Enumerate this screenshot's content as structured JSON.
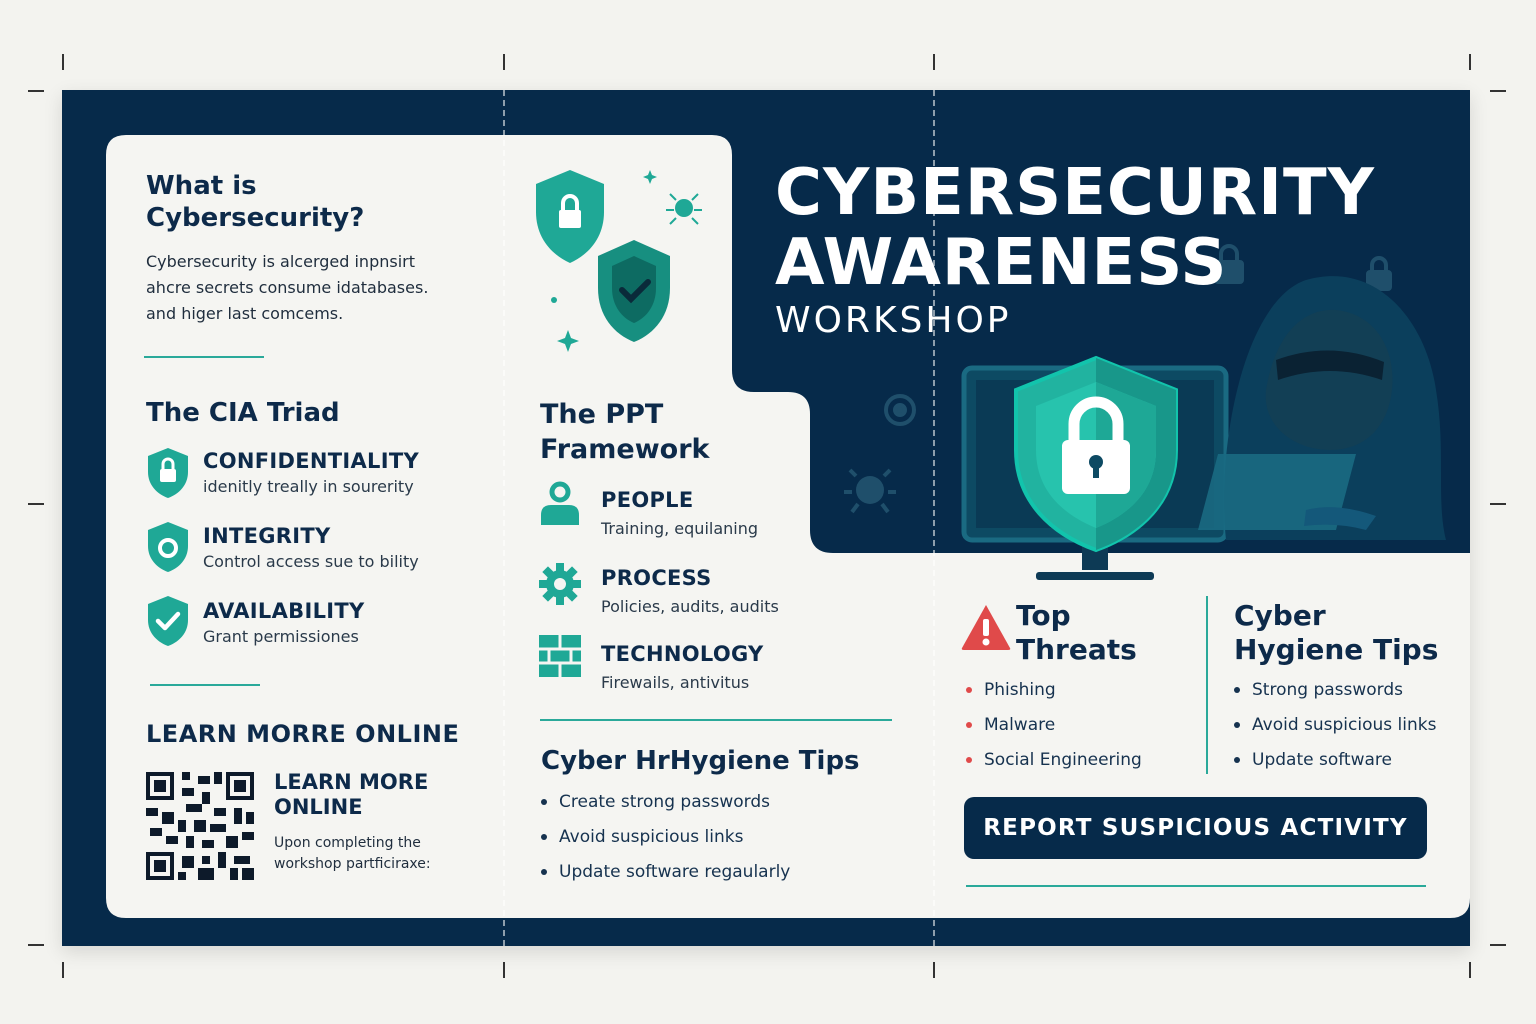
{
  "panel_left": {
    "what_is": {
      "heading": "What is Cybersecurity?",
      "line1": "Cybersecurity is alcerged inpnsirt",
      "line2": "ahcre secrets consume idatabases.",
      "line3": "and higer last comcems."
    },
    "cia": {
      "heading": "The CIA Triad",
      "items": [
        {
          "title": "CONFIDENTIALITY",
          "desc": "idenitly treally in sourerity",
          "icon": "lock-shield-icon"
        },
        {
          "title": "INTEGRITY",
          "desc": "Control access sue to bility",
          "icon": "ring-shield-icon"
        },
        {
          "title": "AVAILABILITY",
          "desc": "Grant permissiones",
          "icon": "check-shield-icon"
        }
      ]
    },
    "learn": {
      "heading": "LEARN MORRE ONLINE",
      "qr_title_1": "LEARN MORE",
      "qr_title_2": "ONLINE",
      "qr_desc_1": "Upon completing the",
      "qr_desc_2": "workshop partficiraxe:"
    }
  },
  "panel_middle": {
    "ppt": {
      "heading_1": "The PPT",
      "heading_2": "Framework",
      "items": [
        {
          "title": "PEOPLE",
          "desc": "Training, equilaning",
          "icon": "person-icon"
        },
        {
          "title": "PROCESS",
          "desc": "Policies, audits, audits",
          "icon": "gear-icon"
        },
        {
          "title": "TECHNOLOGY",
          "desc": "Firewails, antivitus",
          "icon": "firewall-icon"
        }
      ]
    },
    "tips": {
      "heading": "Cyber HrHygiene Tips",
      "items": [
        "Create strong passwords",
        "Avoid suspicious links",
        "Update software regaularly"
      ]
    }
  },
  "panel_right": {
    "title_line1": "CYBERSECURITY",
    "title_line2": "AWARENESS",
    "subtitle": "WORKSHOP",
    "threats": {
      "heading_1": "Top",
      "heading_2": "Threats",
      "items": [
        "Phishing",
        "Malware",
        "Social Engineering"
      ]
    },
    "hygiene": {
      "heading_1": "Cyber",
      "heading_2": "Hygiene Tips",
      "items": [
        "Strong passwords",
        "Avoid suspicious links",
        "Update software"
      ]
    },
    "report_button": "REPORT SUSPICIOUS ACTIVITY"
  },
  "colors": {
    "navy": "#062a4a",
    "teal": "#1fa896",
    "alert_red": "#e04a4a",
    "paper": "#f5f5f2"
  }
}
